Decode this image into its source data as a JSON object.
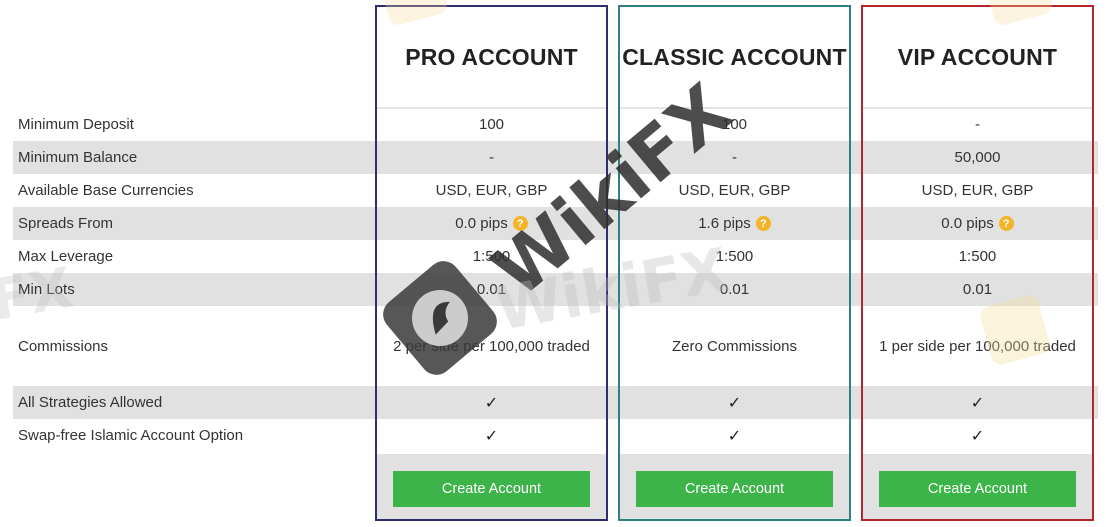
{
  "rows": [
    {
      "label": "Minimum Deposit"
    },
    {
      "label": "Minimum Balance"
    },
    {
      "label": "Available Base Currencies"
    },
    {
      "label": "Spreads From"
    },
    {
      "label": "Max Leverage"
    },
    {
      "label": "Min Lots"
    },
    {
      "label": "Commissions"
    },
    {
      "label": "All Strategies Allowed"
    },
    {
      "label": "Swap-free Islamic Account Option"
    }
  ],
  "accounts": [
    {
      "title": "PRO ACCOUNT",
      "border_color": "#2e2f6e",
      "minimum_deposit": "100",
      "minimum_balance": "-",
      "base_currencies": "USD, EUR, GBP",
      "spreads_from": "0.0 pips",
      "max_leverage": "1:500",
      "min_lots": "0.01",
      "commissions": "2 per side per 100,000 traded",
      "all_strategies": "✓",
      "swap_free": "✓",
      "button_label": "Create Account"
    },
    {
      "title": "CLASSIC ACCOUNT",
      "border_color": "#2f7f86",
      "minimum_deposit": "100",
      "minimum_balance": "-",
      "base_currencies": "USD, EUR, GBP",
      "spreads_from": "1.6 pips",
      "max_leverage": "1:500",
      "min_lots": "0.01",
      "commissions": "Zero Commissions",
      "all_strategies": "✓",
      "swap_free": "✓",
      "button_label": "Create Account"
    },
    {
      "title": "VIP ACCOUNT",
      "border_color": "#b3262a",
      "minimum_deposit": "-",
      "minimum_balance": "50,000",
      "base_currencies": "USD, EUR, GBP",
      "spreads_from": "0.0 pips",
      "max_leverage": "1:500",
      "min_lots": "0.01",
      "commissions": "1 per side per 100,000 traded",
      "all_strategies": "✓",
      "swap_free": "✓",
      "button_label": "Create Account"
    }
  ],
  "icons": {
    "help": "?",
    "check": "✓"
  },
  "colors": {
    "button": "#3cb44a",
    "help_icon": "#f4b428",
    "row_gray": "#e1e1e1"
  },
  "watermark": {
    "text": "WikiFX"
  }
}
